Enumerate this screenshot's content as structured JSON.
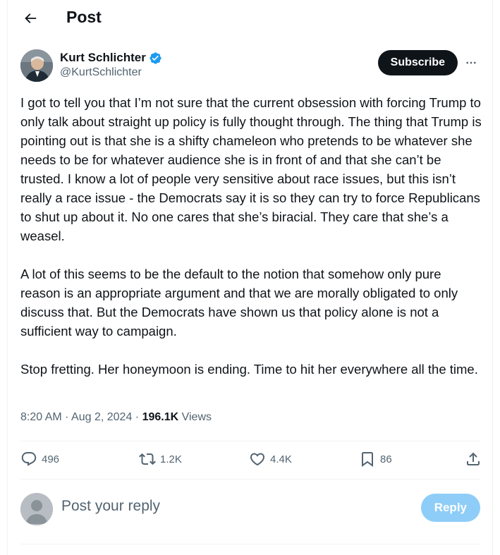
{
  "header": {
    "title": "Post"
  },
  "author": {
    "name": "Kurt Schlichter",
    "handle": "@KurtSchlichter",
    "verified": true,
    "subscribe_label": "Subscribe"
  },
  "post": {
    "paragraphs": [
      "I got to tell you that I’m not sure that the current obsession with forcing Trump to only talk about straight up policy is fully thought through. The thing that Trump is pointing out is that she is a shifty chameleon who pretends to be whatever she needs to be for whatever audience she is in front of and that she can’t be trusted. I know a lot of people very sensitive about race issues, but this isn’t really a race issue - the Democrats say it is so they can try to force Republicans to shut up about it. No one cares that she’s biracial. They care that she’s a weasel.",
      "A lot of this seems to be the default to the notion that somehow only pure reason is an appropriate argument and that we are morally obligated to only discuss that. But the Democrats have shown us that policy alone is not a sufficient way to campaign.",
      "Stop fretting. Her honeymoon is ending. Time to hit her everywhere all the time."
    ],
    "time": "8:20 AM",
    "dot1": " · ",
    "date": "Aug 2, 2024",
    "dot2": " · ",
    "views_count": "196.1K",
    "views_label": " Views"
  },
  "actions": {
    "replies": "496",
    "reposts": "1.2K",
    "likes": "4.4K",
    "bookmarks": "86"
  },
  "reply_box": {
    "placeholder": "Post your reply",
    "button_label": "Reply"
  },
  "colors": {
    "text": "#0f1419",
    "secondary": "#536471",
    "verified": "#1d9bf0",
    "reply_button": "#8ecdf8"
  }
}
